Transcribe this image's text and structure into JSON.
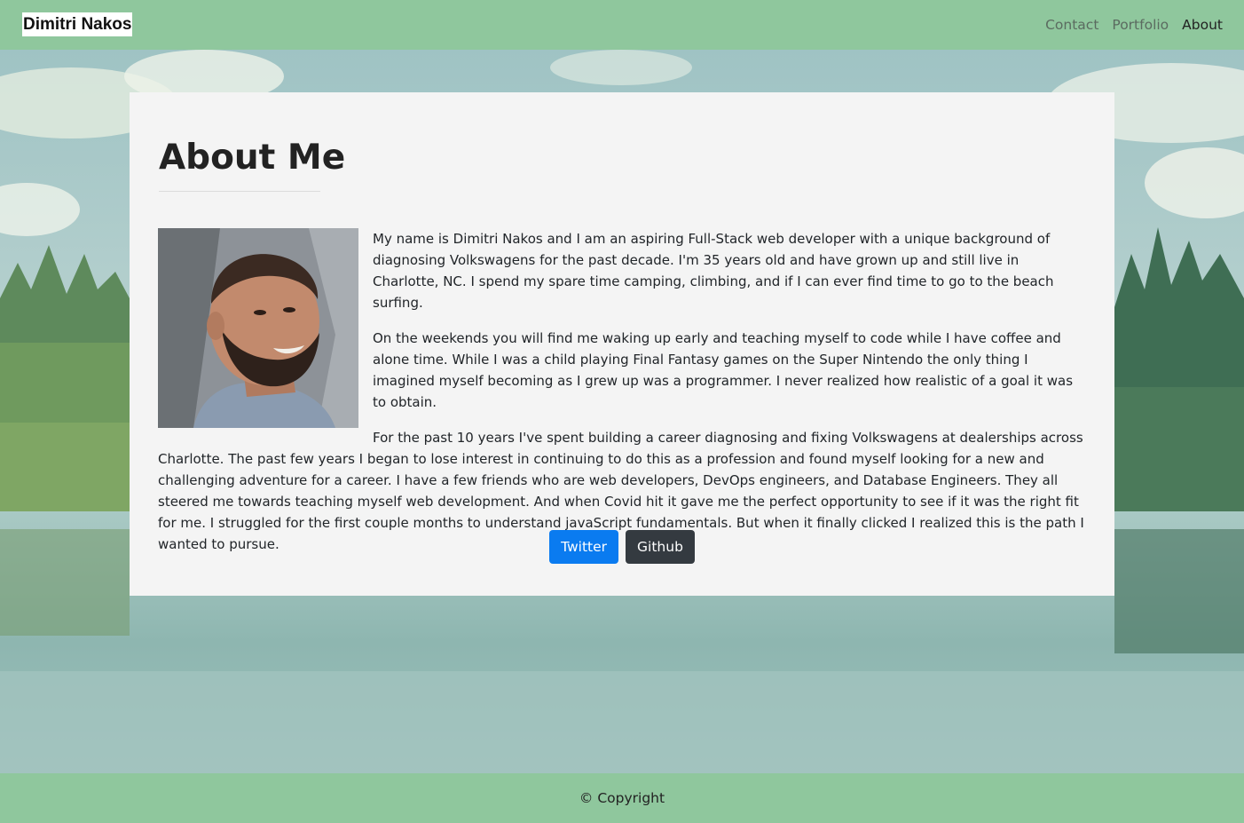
{
  "navbar": {
    "brand": "Dimitri Nakos",
    "links": [
      {
        "label": "Contact"
      },
      {
        "label": "Portfolio"
      },
      {
        "label": "About"
      }
    ]
  },
  "main": {
    "title": "About Me",
    "paragraphs": [
      "My name is Dimitri Nakos and I am an aspiring Full-Stack web developer with a unique background of diagnosing Volkswagens for the past decade. I'm 35 years old and have grown up and still live in Charlotte, NC. I spend my spare time camping, climbing, and if I can ever find time to go to the beach surfing.",
      "On the weekends you will find me waking up early and teaching myself to code while I have coffee and alone time. While I was a child playing Final Fantasy games on the Super Nintendo the only thing I imagined myself becoming as I grew up was a programmer. I never realized how realistic of a goal it was to obtain.",
      "For the past 10 years I've spent building a career diagnosing and fixing Volkswagens at dealerships across Charlotte. The past few years I began to lose interest in continuing to do this as a profession and found myself looking for a new and challenging adventure for a career. I have a few friends who are web developers, DevOps engineers, and Database Engineers. They all steered me towards teaching myself web development. And when Covid hit it gave me the perfect opportunity to see if it was the right fit for me. I struggled for the first couple months to understand javaScript fundamentals. But when it finally clicked I realized this is the path I wanted to pursue."
    ],
    "buttons": {
      "twitter": "Twitter",
      "github": "Github"
    }
  },
  "footer": {
    "copyright": "© Copyright"
  },
  "colors": {
    "navbar_bg": "#8fc79d",
    "card_bg": "#f4f4f4",
    "twitter_btn": "#0a7bf0",
    "github_btn": "#343a40"
  },
  "icons": {
    "photo": "profile-photo"
  }
}
